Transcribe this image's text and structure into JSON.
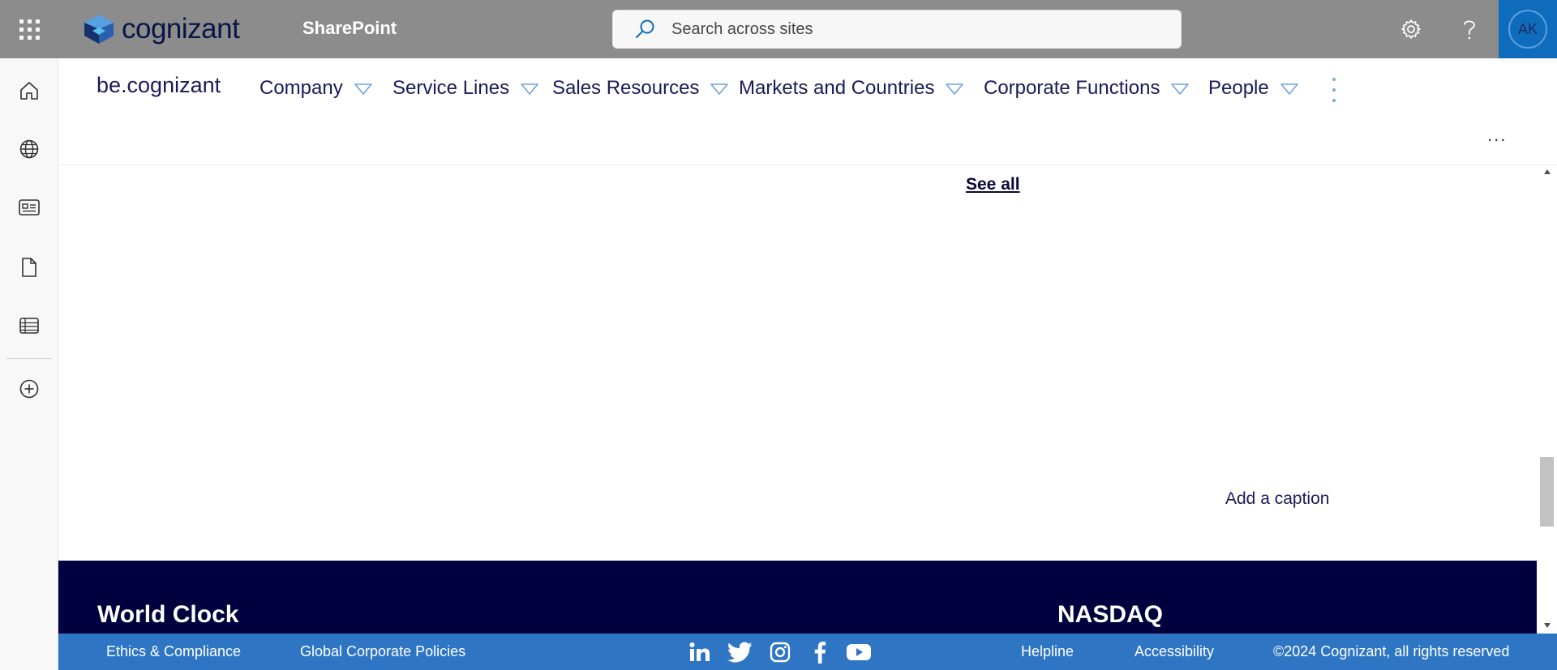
{
  "suite": {
    "brand": "cognizant",
    "app_name": "SharePoint",
    "search_placeholder": "Search across sites",
    "avatar_initials": "AK"
  },
  "appbar": {
    "items": [
      "home-icon",
      "globe-icon",
      "news-icon",
      "file-icon",
      "list-icon",
      "add-circle-icon"
    ]
  },
  "hubnav": {
    "site_title": "be.cognizant",
    "items": [
      {
        "label": "Company"
      },
      {
        "label": "Service Lines"
      },
      {
        "label": "Sales Resources"
      },
      {
        "label": "Markets and Countries"
      },
      {
        "label": "Corporate Functions"
      },
      {
        "label": "People"
      }
    ],
    "more_label": "..."
  },
  "content": {
    "see_all": "See all",
    "caption_placeholder": "Add a caption"
  },
  "darkband": {
    "left_heading": "World Clock",
    "right_heading": "NASDAQ"
  },
  "footer": {
    "links": [
      "Ethics & Compliance",
      "Global Corporate Policies",
      "Helpline",
      "Accessibility"
    ],
    "social": [
      "linkedin-icon",
      "twitter-icon",
      "instagram-icon",
      "facebook-icon",
      "youtube-icon"
    ],
    "copyright": "©2024 Cognizant, all rights reserved"
  },
  "colors": {
    "suite_bar": "#8c8c8c",
    "avatar_bg": "#0f6cbd",
    "nav_text": "#1a1a5a",
    "dark_band": "#00003f",
    "footer": "#2e75c4"
  }
}
